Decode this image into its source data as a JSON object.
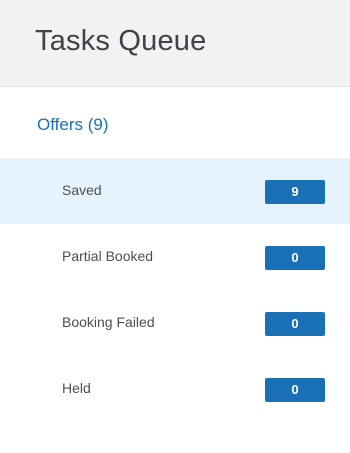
{
  "header": {
    "title": "Tasks Queue"
  },
  "offers": {
    "title": "Offers (9)",
    "items": [
      {
        "label": "Saved",
        "count": "9",
        "selected": true
      },
      {
        "label": "Partial Booked",
        "count": "0",
        "selected": false
      },
      {
        "label": "Booking Failed",
        "count": "0",
        "selected": false
      },
      {
        "label": "Held",
        "count": "0",
        "selected": false
      }
    ]
  },
  "colors": {
    "accent": "#1a70b7",
    "header_bg": "#f1f2f3",
    "selected_bg": "#e7f3fc",
    "text": "#4b4f55"
  }
}
